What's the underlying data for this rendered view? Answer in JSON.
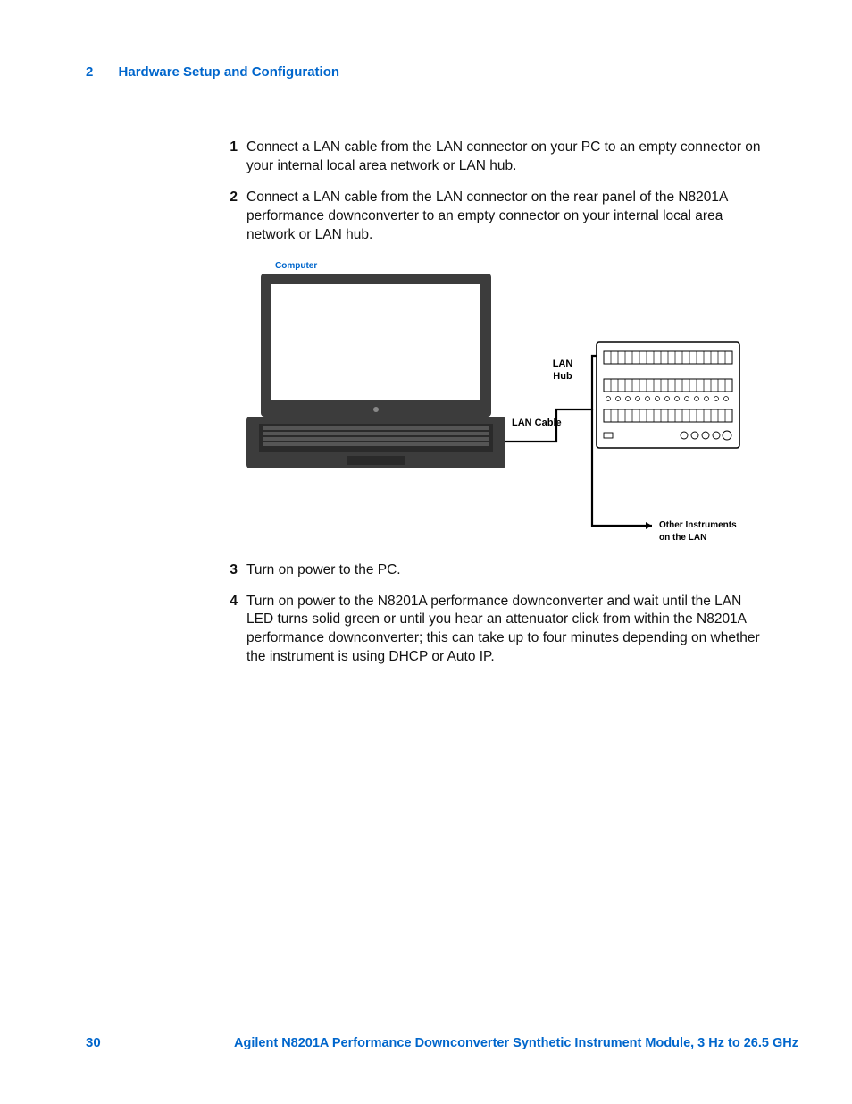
{
  "header": {
    "chapter_number": "2",
    "chapter_title": "Hardware Setup and Configuration"
  },
  "steps": [
    {
      "num": "1",
      "text": "Connect a LAN cable from the LAN connector on your PC to an empty connector on your internal local area network or LAN hub."
    },
    {
      "num": "2",
      "text": "Connect a LAN cable from the LAN connector on the rear panel of the N8201A performance downconverter to an empty connector on your internal local area network or LAN hub."
    },
    {
      "num": "3",
      "text": "Turn on power to the PC."
    },
    {
      "num": "4",
      "text": "Turn on power to the N8201A performance downconverter and wait until the LAN LED turns solid green or until you hear an attenuator click from within the N8201A performance downconverter; this can take up to four minutes depending on whether the instrument is using DHCP or Auto IP."
    }
  ],
  "diagram": {
    "labels": {
      "computer": "Computer",
      "lan_hub": "LAN Hub",
      "lan_cable": "LAN Cable",
      "other_instruments_line1": "Other Instruments",
      "other_instruments_line2": "on the LAN"
    }
  },
  "footer": {
    "page_number": "30",
    "title": "Agilent N8201A Performance Downconverter Synthetic Instrument Module, 3 Hz to 26.5 GHz"
  }
}
